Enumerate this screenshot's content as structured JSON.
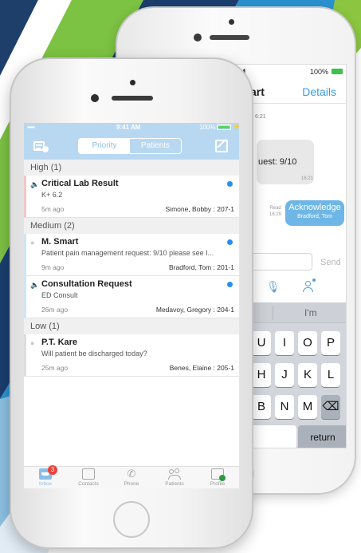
{
  "back_phone": {
    "status": {
      "time": "41 AM",
      "battery": "100%"
    },
    "title": "art",
    "details_label": "Details",
    "time_top": "6:21",
    "bubble_text": "uest: 9/10",
    "bubble_time": "16:21",
    "read_label": "Read",
    "read_time": "16:29",
    "acknowledge": {
      "label": "Acknowledge",
      "by": "Bradford, Tom"
    },
    "send_label": "Send",
    "suggestion": "I'm",
    "keys_row1": [
      "U",
      "I",
      "O",
      "P"
    ],
    "keys_row2": [
      "H",
      "J",
      "K",
      "L"
    ],
    "keys_row3": [
      "B",
      "N",
      "M"
    ],
    "return_label": "return"
  },
  "front_phone": {
    "status": {
      "signal": "•••••",
      "time": "9:41 AM",
      "battery": "100%",
      "colors": {
        "bar": "#b8d8f1",
        "battery_fill": "#56d45c"
      }
    },
    "segment": {
      "priority_label": "Priority",
      "patients_label": "Patients"
    },
    "sections": [
      {
        "label": "High",
        "count": "(1)",
        "items": [
          {
            "title": "Critical Lab Result",
            "subtitle": "K+ 6.2",
            "ago": "5m ago",
            "who": "Simone, Bobby : 207-1",
            "unread": true,
            "bar_color": "#f3c7c7",
            "icon": "speaker-icon"
          }
        ]
      },
      {
        "label": "Medium",
        "count": "(2)",
        "items": [
          {
            "title": "M. Smart",
            "subtitle": "Patient pain management request: 9/10 please see I...",
            "ago": "9m ago",
            "who": "Bradford, Tom : 201-1",
            "unread": true,
            "bar_color": "#cfe4f6",
            "icon": "chat-bubble-icon"
          },
          {
            "title": "Consultation Request",
            "subtitle": "ED Consult",
            "ago": "26m ago",
            "who": "Medavoy, Gregory : 204-1",
            "unread": true,
            "bar_color": "#cfe4f6",
            "icon": "speaker-icon"
          }
        ]
      },
      {
        "label": "Low",
        "count": "(1)",
        "items": [
          {
            "title": "P.T. Kare",
            "subtitle": "Will patient be discharged today?",
            "ago": "25m ago",
            "who": "Benes, Elaine : 205-1",
            "unread": false,
            "bar_color": "#dddddd",
            "icon": "chat-bubble-icon"
          }
        ]
      }
    ],
    "tabs": [
      {
        "label": "Inbox",
        "badge": "3",
        "icon": "inbox-icon"
      },
      {
        "label": "Contacts",
        "icon": "contacts-icon"
      },
      {
        "label": "Phone",
        "icon": "phone-icon"
      },
      {
        "label": "Patients",
        "icon": "patients-icon"
      },
      {
        "label": "Profile",
        "icon": "profile-icon"
      }
    ],
    "accent": "#8cbde6",
    "unread_dot": "#2a8ef0",
    "badge_color": "#e8443a"
  }
}
